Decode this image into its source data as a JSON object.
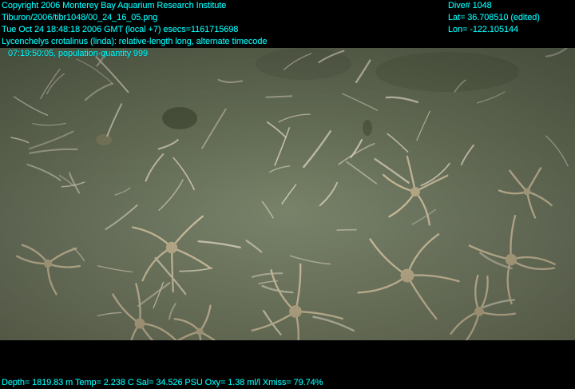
{
  "overlay": {
    "copyright": "Copyright 2006 Monterey Bay Aquarium Research Institute",
    "file_path": "Tiburon/2006/tibr1048/00_24_16_05.png",
    "datetime": "Tue Oct 24 18:48:18 2006 GMT (local +7)  esecs=1161715698",
    "annotation_line1": "Lycenchelys crotalinus (linda): relative-length long, alternate timecode",
    "annotation_line2": "07:19:50:05, population-quantity 999",
    "dive": "Dive# 1048",
    "lat": "Lat= 36.708510 (edited)",
    "lon": "Lon= -122.105144",
    "sensors": "Depth= 1819.83 m  Temp= 2.238 C  Sal= 34.526 PSU  Oxy= 1.38 ml/l  Xmiss= 79.74%"
  },
  "colors": {
    "overlay_text": "#00ffff",
    "seafloor": "#737d62",
    "brittle_star": "#d8c9a6"
  }
}
